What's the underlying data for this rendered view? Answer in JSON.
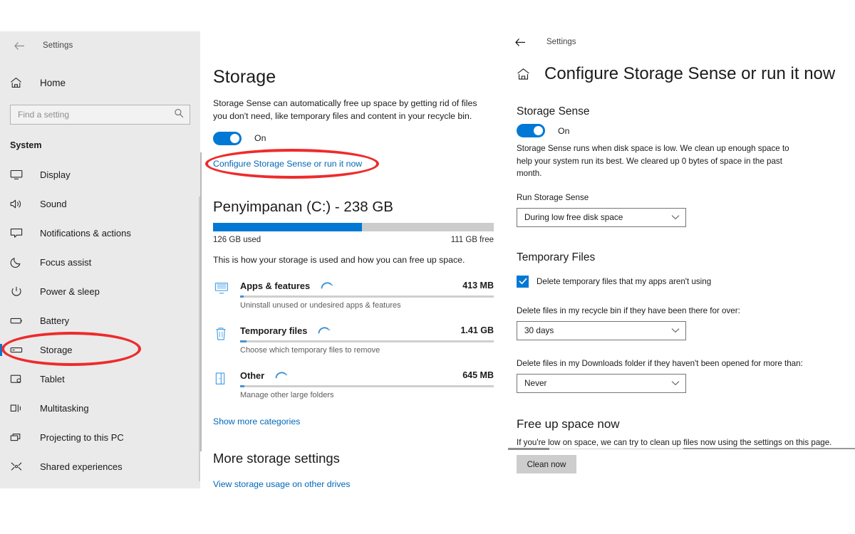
{
  "sidebar": {
    "back_icon": "arrow-left-icon",
    "title": "Settings",
    "home_label": "Home",
    "home_icon": "home-icon",
    "search": {
      "placeholder": "Find a setting",
      "value": "",
      "icon": "search-icon"
    },
    "group_label": "System",
    "items": [
      {
        "label": "Display",
        "icon": "display-icon",
        "selected": false
      },
      {
        "label": "Sound",
        "icon": "sound-icon",
        "selected": false
      },
      {
        "label": "Notifications & actions",
        "icon": "notifications-icon",
        "selected": false
      },
      {
        "label": "Focus assist",
        "icon": "moon-icon",
        "selected": false
      },
      {
        "label": "Power & sleep",
        "icon": "power-icon",
        "selected": false
      },
      {
        "label": "Battery",
        "icon": "battery-icon",
        "selected": false
      },
      {
        "label": "Storage",
        "icon": "storage-icon",
        "selected": true
      },
      {
        "label": "Tablet",
        "icon": "tablet-icon",
        "selected": false
      },
      {
        "label": "Multitasking",
        "icon": "multitasking-icon",
        "selected": false
      },
      {
        "label": "Projecting to this PC",
        "icon": "projecting-icon",
        "selected": false
      },
      {
        "label": "Shared experiences",
        "icon": "shared-experiences-icon",
        "selected": false
      }
    ]
  },
  "middle": {
    "title": "Storage",
    "description": "Storage Sense can automatically free up space by getting rid of files you don't need, like temporary files and content in your recycle bin.",
    "toggle_state": "On",
    "configure_link": "Configure Storage Sense or run it now",
    "drive": {
      "title": "Penyimpanan (C:) - 238 GB",
      "used_label": "126 GB used",
      "free_label": "111 GB free",
      "used_percent": 53,
      "hint": "This is how your storage is used and how you can free up space."
    },
    "categories": [
      {
        "name": "Apps & features",
        "size": "413 MB",
        "hint": "Uninstall unused or undesired apps & features",
        "icon": "display-apps-icon",
        "bar_percent": 1.5
      },
      {
        "name": "Temporary files",
        "size": "1.41 GB",
        "hint": "Choose which temporary files to remove",
        "icon": "trash-icon",
        "bar_percent": 2.5
      },
      {
        "name": "Other",
        "size": "645 MB",
        "hint": "Manage other large folders",
        "icon": "folder-open-icon",
        "bar_percent": 1.8
      }
    ],
    "show_more_link": "Show more categories",
    "more_settings_title": "More storage settings",
    "other_drives_link": "View storage usage on other drives"
  },
  "right": {
    "back_icon": "arrow-left-icon",
    "topbar_title": "Settings",
    "home_icon": "home-icon",
    "page_title": "Configure Storage Sense or run it now",
    "storage_sense": {
      "heading": "Storage Sense",
      "toggle_state": "On",
      "description": "Storage Sense runs when disk space is low. We clean up enough space to help your system run its best. We cleared up 0 bytes of space in the past month.",
      "run_label": "Run Storage Sense",
      "run_value": "During low free disk space"
    },
    "temporary_files": {
      "heading": "Temporary Files",
      "checkbox_label": "Delete temporary files that my apps aren't using",
      "checkbox_checked": true,
      "recycle_label": "Delete files in my recycle bin if they have been there for over:",
      "recycle_value": "30 days",
      "downloads_label": "Delete files in my Downloads folder if they haven't been opened for more than:",
      "downloads_value": "Never"
    },
    "free_up": {
      "heading": "Free up space now",
      "description": "If you're low on space, we can try to clean up files now using the settings on this page.",
      "button_label": "Clean now"
    }
  },
  "colors": {
    "accent": "#0078d4",
    "link": "#0067b8",
    "annotation": "#ee2b2b",
    "sidebar_bg": "#eaeaea"
  }
}
